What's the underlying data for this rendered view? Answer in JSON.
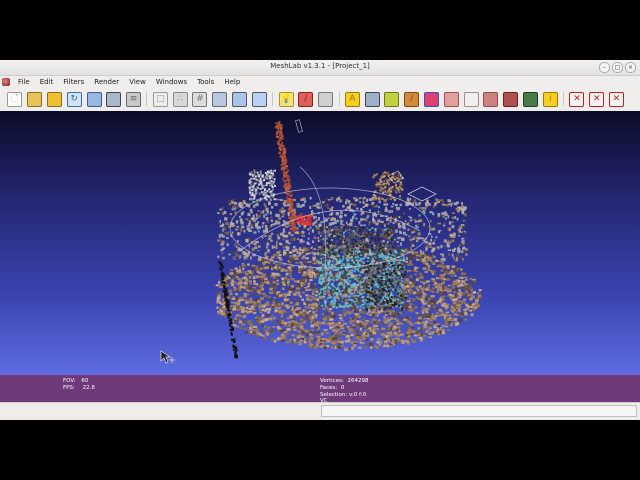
{
  "window": {
    "title": "MeshLab v1.3.1 - [Project_1]"
  },
  "menu": [
    "File",
    "Edit",
    "Filters",
    "Render",
    "View",
    "Windows",
    "Tools",
    "Help"
  ],
  "toolbar_icons": [
    "new-project-icon",
    "open-project-icon",
    "open-mesh-icon",
    "reload-icon",
    "save-icon",
    "snapshot-icon",
    "layers-icon",
    "sep",
    "bbox-icon",
    "points-icon",
    "wireframe-icon",
    "flat-lines-icon",
    "flat-icon",
    "smooth-icon",
    "sep",
    "light-icon",
    "backface-icon",
    "texture-icon",
    "sep",
    "annotation-icon",
    "align-icon",
    "paint-icon",
    "brush-icon",
    "color-picker-icon",
    "select-faces-icon",
    "select-vertices-icon",
    "manipulator-icon",
    "measure-icon",
    "qr-icon",
    "info-icon",
    "sep",
    "delete-faces-icon",
    "delete-vertices-icon",
    "delete-selection-icon"
  ],
  "info": {
    "fov_label": "FOV:",
    "fov_value": "60",
    "fps_label": "FPS:",
    "fps_value": "22.8",
    "vertices_label": "Vertices:",
    "vertices_value": "264298",
    "faces_label": "Faces:",
    "faces_value": "0",
    "selection_label": "Selection: v:0 f:0",
    "vc_label": "VC"
  },
  "colors": {
    "info_bar": "#6e3a7a",
    "viewport_top": "#0b0b28",
    "viewport_bottom": "#5f6ce0"
  }
}
